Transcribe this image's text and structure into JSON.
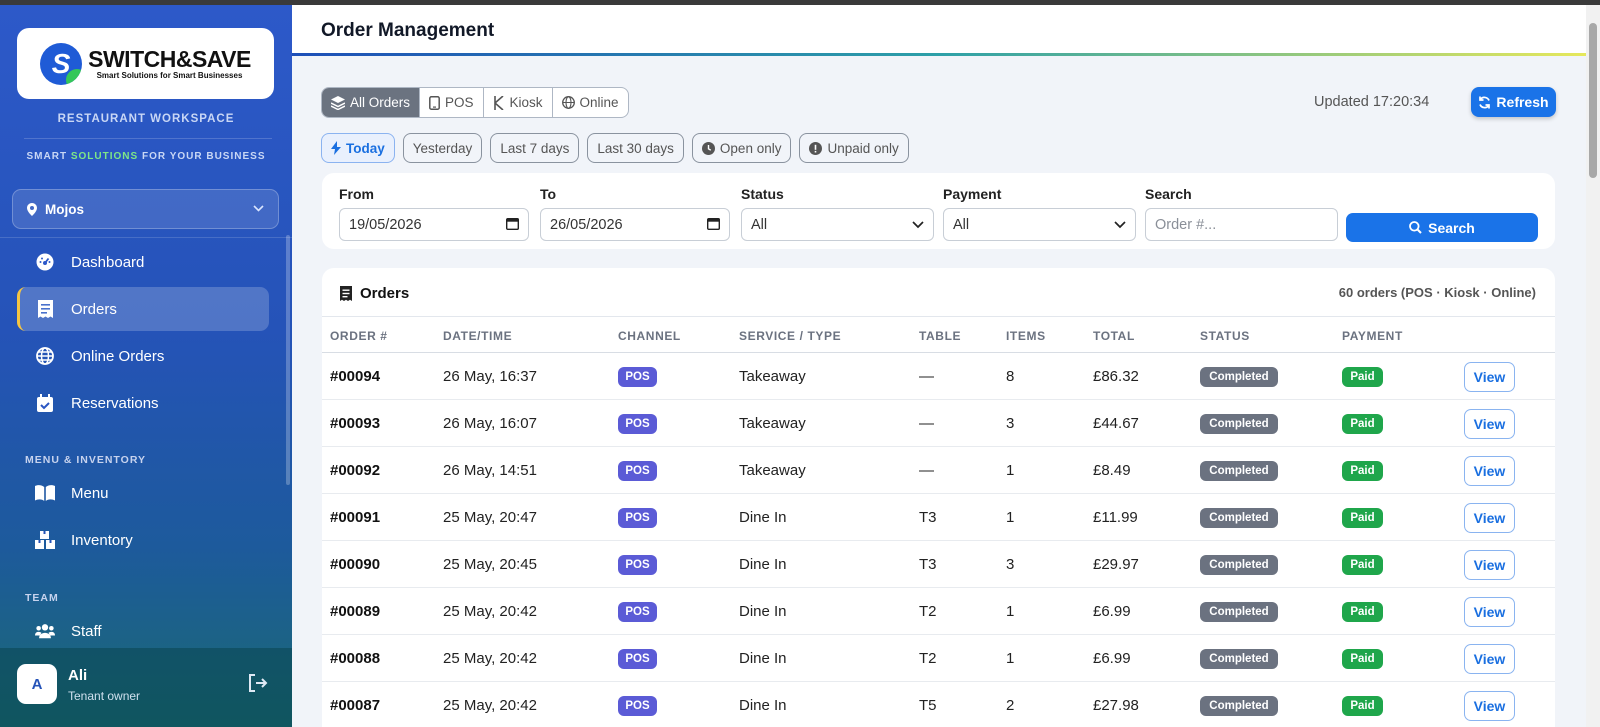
{
  "brand": {
    "logo_letter": "S",
    "name": "SWITCH&SAVE",
    "tagline": "Smart Solutions for Smart Businesses"
  },
  "sidebar": {
    "workspace_label": "RESTAURANT WORKSPACE",
    "tagline_prefix": "SMART",
    "tagline_highlight": "SOLUTIONS",
    "tagline_suffix": "FOR YOUR BUSINESS",
    "location": "Mojos",
    "nav": [
      {
        "label": "Dashboard",
        "icon": "dashboard-icon"
      },
      {
        "label": "Orders",
        "icon": "receipt-icon",
        "active": true
      },
      {
        "label": "Online Orders",
        "icon": "globe-icon"
      },
      {
        "label": "Reservations",
        "icon": "calendar-check-icon"
      }
    ],
    "section_menu": "MENU & INVENTORY",
    "nav_menu": [
      {
        "label": "Menu",
        "icon": "book-icon"
      },
      {
        "label": "Inventory",
        "icon": "boxes-icon"
      }
    ],
    "section_team": "TEAM",
    "nav_team": [
      {
        "label": "Staff",
        "icon": "users-icon"
      }
    ],
    "user": {
      "initial": "A",
      "name": "Ali",
      "role": "Tenant owner"
    }
  },
  "header": {
    "title": "Order Management"
  },
  "channel_tabs": [
    "All Orders",
    "POS",
    "Kiosk",
    "Online"
  ],
  "updated": "Updated 17:20:34",
  "refresh_label": "Refresh",
  "quick_filters": [
    "Today",
    "Yesterday",
    "Last 7 days",
    "Last 30 days",
    "Open only",
    "Unpaid only"
  ],
  "filters": {
    "from_label": "From",
    "from_value": "19/05/2026",
    "to_label": "To",
    "to_value": "26/05/2026",
    "status_label": "Status",
    "status_value": "All",
    "payment_label": "Payment",
    "payment_value": "All",
    "search_label": "Search",
    "search_placeholder": "Order #...",
    "search_button": "Search"
  },
  "orders": {
    "title": "Orders",
    "count": "60 orders (POS · Kiosk · Online)",
    "columns": [
      "ORDER #",
      "DATE/TIME",
      "CHANNEL",
      "SERVICE / TYPE",
      "TABLE",
      "ITEMS",
      "TOTAL",
      "STATUS",
      "PAYMENT"
    ],
    "rows": [
      {
        "id": "#00094",
        "datetime": "26 May, 16:37",
        "channel": "POS",
        "service": "Takeaway",
        "table": "—",
        "items": "8",
        "total": "£86.32",
        "status": "Completed",
        "payment": "Paid",
        "action": "View"
      },
      {
        "id": "#00093",
        "datetime": "26 May, 16:07",
        "channel": "POS",
        "service": "Takeaway",
        "table": "—",
        "items": "3",
        "total": "£44.67",
        "status": "Completed",
        "payment": "Paid",
        "action": "View"
      },
      {
        "id": "#00092",
        "datetime": "26 May, 14:51",
        "channel": "POS",
        "service": "Takeaway",
        "table": "—",
        "items": "1",
        "total": "£8.49",
        "status": "Completed",
        "payment": "Paid",
        "action": "View"
      },
      {
        "id": "#00091",
        "datetime": "25 May, 20:47",
        "channel": "POS",
        "service": "Dine In",
        "table": "T3",
        "items": "1",
        "total": "£11.99",
        "status": "Completed",
        "payment": "Paid",
        "action": "View"
      },
      {
        "id": "#00090",
        "datetime": "25 May, 20:45",
        "channel": "POS",
        "service": "Dine In",
        "table": "T3",
        "items": "3",
        "total": "£29.97",
        "status": "Completed",
        "payment": "Paid",
        "action": "View"
      },
      {
        "id": "#00089",
        "datetime": "25 May, 20:42",
        "channel": "POS",
        "service": "Dine In",
        "table": "T2",
        "items": "1",
        "total": "£6.99",
        "status": "Completed",
        "payment": "Paid",
        "action": "View"
      },
      {
        "id": "#00088",
        "datetime": "25 May, 20:42",
        "channel": "POS",
        "service": "Dine In",
        "table": "T2",
        "items": "1",
        "total": "£6.99",
        "status": "Completed",
        "payment": "Paid",
        "action": "View"
      },
      {
        "id": "#00087",
        "datetime": "25 May, 20:42",
        "channel": "POS",
        "service": "Dine In",
        "table": "T5",
        "items": "2",
        "total": "£27.98",
        "status": "Completed",
        "payment": "Paid",
        "action": "View"
      }
    ]
  },
  "colors": {
    "accent": "#1a73e8",
    "pos_badge": "#5b5bd6",
    "status_badge": "#6b7280",
    "paid_badge": "#1fa64b",
    "active_border": "#f5c542"
  }
}
